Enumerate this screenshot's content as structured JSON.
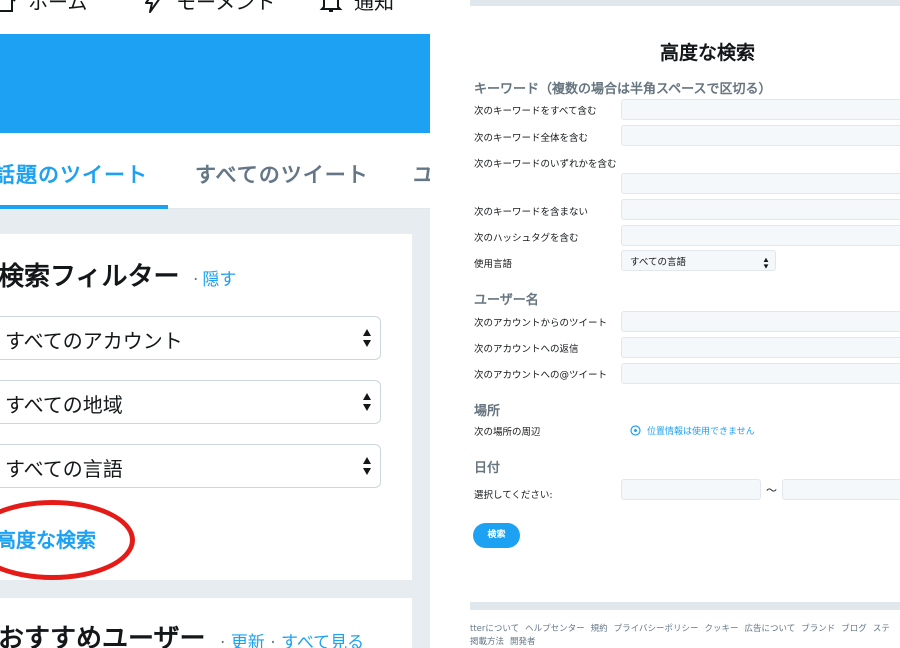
{
  "left": {
    "nav": {
      "home": "ホーム",
      "moments": "モーメント",
      "notifications": "通知"
    },
    "tabs": [
      "話題のツイート",
      "すべてのツイート",
      "ユ"
    ],
    "filter": {
      "title": "検索フィルター",
      "hide_dot": "·",
      "hide": "隠す",
      "selects": [
        "すべてのアカウント",
        "すべての地域",
        "すべての言語"
      ],
      "advanced_link": "高度な検索"
    },
    "recommend": {
      "title": "おすすめユーザー",
      "dot": "·",
      "refresh": "更新",
      "see_all": "すべて見る"
    },
    "colors": {
      "accent": "#1da1f2",
      "highlight": "#e41b17",
      "background": "#e6ecf0"
    }
  },
  "right": {
    "title": "高度な検索",
    "keyword_section": "キーワード（複数の場合は半角スペースで区切る）",
    "keyword_labels": {
      "all": "次のキーワードをすべて含む",
      "phrase": "次のキーワード全体を含む",
      "any": "次のキーワードのいずれかを含む",
      "none": "次のキーワードを含まない",
      "hashtag": "次のハッシュタグを含む",
      "language": "使用言語"
    },
    "language_select": "すべての言語",
    "user_section": "ユーザー名",
    "user_labels": {
      "from": "次のアカウントからのツイート",
      "reply": "次のアカウントへの返信",
      "mention": "次のアカウントへの@ツイート"
    },
    "place_section": "場所",
    "place_label": "次の場所の周辺",
    "location_unavailable": "位置情報は使用できません",
    "date_section": "日付",
    "date_label": "選択してください:",
    "date_separator": "〜",
    "search_button": "検索",
    "footer_links": [
      "tterについて",
      "ヘルプセンター",
      "規約",
      "プライバシーポリシー",
      "クッキー",
      "広告について",
      "ブランド",
      "ブログ",
      "ステ",
      "掲載方法",
      "開発者"
    ]
  }
}
